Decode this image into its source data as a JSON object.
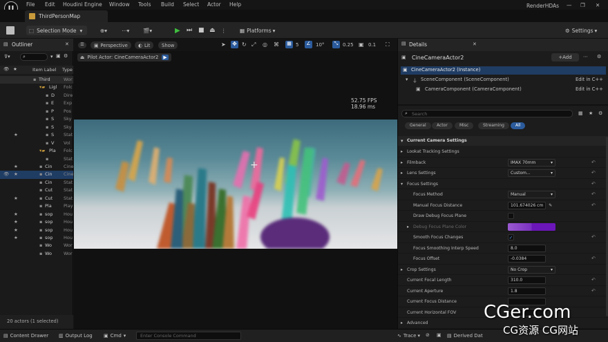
{
  "menubar": {
    "items": [
      "File",
      "Edit",
      "Houdini Engine",
      "Window",
      "Tools",
      "Build",
      "Select",
      "Actor",
      "Help"
    ],
    "project_name": "RenderHDAs"
  },
  "tab": {
    "title": "ThirdPersonMap"
  },
  "toolbar": {
    "mode_label": "Selection Mode",
    "platforms_label": "Platforms",
    "settings_label": "Settings"
  },
  "outliner": {
    "title": "Outliner",
    "col_label": "Item Label",
    "col_type": "Type",
    "rows": [
      {
        "indent": 2,
        "label": "Third",
        "type": "Wor",
        "star": false,
        "eye": false,
        "folder": false,
        "selected": true
      },
      {
        "indent": 3,
        "label": "Ligl",
        "type": "Folc",
        "star": false,
        "eye": false,
        "folder": true,
        "selected": false
      },
      {
        "indent": 4,
        "label": "D",
        "type": "Dire",
        "star": false,
        "eye": false,
        "folder": false,
        "selected": false
      },
      {
        "indent": 4,
        "label": "E",
        "type": "Exp",
        "star": false,
        "eye": false,
        "folder": false,
        "selected": false
      },
      {
        "indent": 4,
        "label": "P",
        "type": "Pos",
        "star": false,
        "eye": false,
        "folder": false,
        "selected": false
      },
      {
        "indent": 4,
        "label": "S",
        "type": "Sky",
        "star": false,
        "eye": false,
        "folder": false,
        "selected": false
      },
      {
        "indent": 4,
        "label": "S",
        "type": "Sky",
        "star": false,
        "eye": false,
        "folder": false,
        "selected": false
      },
      {
        "indent": 4,
        "label": "S",
        "type": "Stat",
        "star": true,
        "eye": false,
        "folder": false,
        "selected": false
      },
      {
        "indent": 4,
        "label": "V",
        "type": "Vol",
        "star": false,
        "eye": false,
        "folder": false,
        "selected": false
      },
      {
        "indent": 3,
        "label": "Pla",
        "type": "Folc",
        "star": false,
        "eye": false,
        "folder": true,
        "selected": false
      },
      {
        "indent": 4,
        "label": "",
        "type": "Stat",
        "star": false,
        "eye": false,
        "folder": false,
        "selected": false
      },
      {
        "indent": 3,
        "label": "Cin",
        "type": "Cine",
        "star": true,
        "eye": false,
        "folder": false,
        "selected": false
      },
      {
        "indent": 3,
        "label": "Cin",
        "type": "Cine",
        "star": true,
        "eye": true,
        "folder": false,
        "selected": true
      },
      {
        "indent": 3,
        "label": "Cin",
        "type": "Stat",
        "star": false,
        "eye": false,
        "folder": false,
        "selected": false
      },
      {
        "indent": 3,
        "label": "Cut",
        "type": "Stat",
        "star": false,
        "eye": false,
        "folder": false,
        "selected": false
      },
      {
        "indent": 3,
        "label": "Cut",
        "type": "Stat",
        "star": true,
        "eye": false,
        "folder": false,
        "selected": false
      },
      {
        "indent": 3,
        "label": "Pla",
        "type": "Play",
        "star": false,
        "eye": false,
        "folder": false,
        "selected": false
      },
      {
        "indent": 3,
        "label": "sop",
        "type": "Hou",
        "star": true,
        "eye": false,
        "folder": false,
        "selected": false
      },
      {
        "indent": 3,
        "label": "sop",
        "type": "Hou",
        "star": true,
        "eye": false,
        "folder": false,
        "selected": false
      },
      {
        "indent": 3,
        "label": "sop",
        "type": "Hou",
        "star": true,
        "eye": false,
        "folder": false,
        "selected": false
      },
      {
        "indent": 3,
        "label": "sop",
        "type": "Hou",
        "star": true,
        "eye": false,
        "folder": false,
        "selected": false
      },
      {
        "indent": 3,
        "label": "Wo",
        "type": "Wor",
        "star": false,
        "eye": false,
        "folder": false,
        "selected": false
      },
      {
        "indent": 3,
        "label": "Wo",
        "type": "Wor",
        "star": false,
        "eye": false,
        "folder": false,
        "selected": false
      }
    ],
    "status": "20 actors (1 selected)"
  },
  "viewport": {
    "perspective_label": "Perspective",
    "lit_label": "Lit",
    "show_label": "Show",
    "grid_value": "5",
    "angle_value": "10°",
    "scale_value": "0.25",
    "cam_speed": "0.1",
    "pilot_label": "Pilot Actor: CineCameraActor2",
    "fps": "52.75 FPS",
    "ms": "18.96 ms"
  },
  "details": {
    "title": "Details",
    "actor_name": "CineCameraActor2",
    "add_label": "+Add",
    "instance_label": "CineCameraActor2 (Instance)",
    "components": [
      {
        "label": "SceneComponent (SceneComponent)",
        "edit": "Edit in C++"
      },
      {
        "label": "CameraComponent (CameraComponent)",
        "edit": "Edit in C++"
      }
    ],
    "search_placeholder": "Search",
    "categories": [
      "General",
      "Actor",
      "Misc",
      "Streaming",
      "All"
    ],
    "section_title": "Current Camera Settings",
    "rows": [
      {
        "name": "Lookat Tracking Settings",
        "value": "",
        "indent": 1,
        "arrow": true,
        "reset": false,
        "kind": "none"
      },
      {
        "name": "Filmback",
        "value": "IMAX 70mm",
        "indent": 1,
        "arrow": true,
        "reset": true,
        "kind": "dropdown"
      },
      {
        "name": "Lens Settings",
        "value": "Custom...",
        "indent": 1,
        "arrow": true,
        "reset": true,
        "kind": "dropdown"
      },
      {
        "name": "Focus Settings",
        "value": "",
        "indent": 1,
        "arrow": true,
        "reset": true,
        "kind": "none"
      },
      {
        "name": "Focus Method",
        "value": "Manual",
        "indent": 2,
        "arrow": false,
        "reset": true,
        "kind": "dropdown"
      },
      {
        "name": "Manual Focus Distance",
        "value": "101.674026 cm",
        "indent": 2,
        "arrow": false,
        "reset": true,
        "kind": "text"
      },
      {
        "name": "Draw Debug Focus Plane",
        "value": "",
        "indent": 2,
        "arrow": false,
        "reset": false,
        "kind": "checkbox"
      },
      {
        "name": "Debug Focus Plane Color",
        "value": "",
        "indent": 2,
        "arrow": true,
        "reset": false,
        "kind": "color"
      },
      {
        "name": "Smooth Focus Changes",
        "value": "",
        "indent": 2,
        "arrow": false,
        "reset": true,
        "kind": "checked"
      },
      {
        "name": "Focus Smoothing Interp Speed",
        "value": "8.0",
        "indent": 2,
        "arrow": false,
        "reset": false,
        "kind": "text"
      },
      {
        "name": "Focus Offset",
        "value": "-0.0384",
        "indent": 2,
        "arrow": false,
        "reset": true,
        "kind": "text"
      },
      {
        "name": "Crop Settings",
        "value": "No Crop",
        "indent": 1,
        "arrow": true,
        "reset": false,
        "kind": "dropdown"
      },
      {
        "name": "Current Focal Length",
        "value": "310.0",
        "indent": 1,
        "arrow": false,
        "reset": true,
        "kind": "text"
      },
      {
        "name": "Current Aperture",
        "value": "1.8",
        "indent": 1,
        "arrow": false,
        "reset": true,
        "kind": "text"
      },
      {
        "name": "Current Focus Distance",
        "value": "",
        "indent": 1,
        "arrow": false,
        "reset": false,
        "kind": "text"
      },
      {
        "name": "Current Horizontal FOV",
        "value": "",
        "indent": 1,
        "arrow": false,
        "reset": false,
        "kind": "text"
      },
      {
        "name": "Advanced",
        "value": "",
        "indent": 1,
        "arrow": true,
        "reset": false,
        "kind": "none"
      }
    ],
    "color_swatch": "#6a16b8"
  },
  "bottombar": {
    "content_drawer": "Content Drawer",
    "output_log": "Output Log",
    "cmd": "Cmd",
    "console_placeholder": "Enter Console Command",
    "trace": "Trace",
    "derived": "Derived Dat"
  },
  "watermark": {
    "line1": "CGer.com",
    "line2": "CG资源 CG网站"
  },
  "colors": {
    "accent": "#2b5b9c",
    "play_green": "#3fbf3f",
    "selection": "#1f3c63"
  }
}
